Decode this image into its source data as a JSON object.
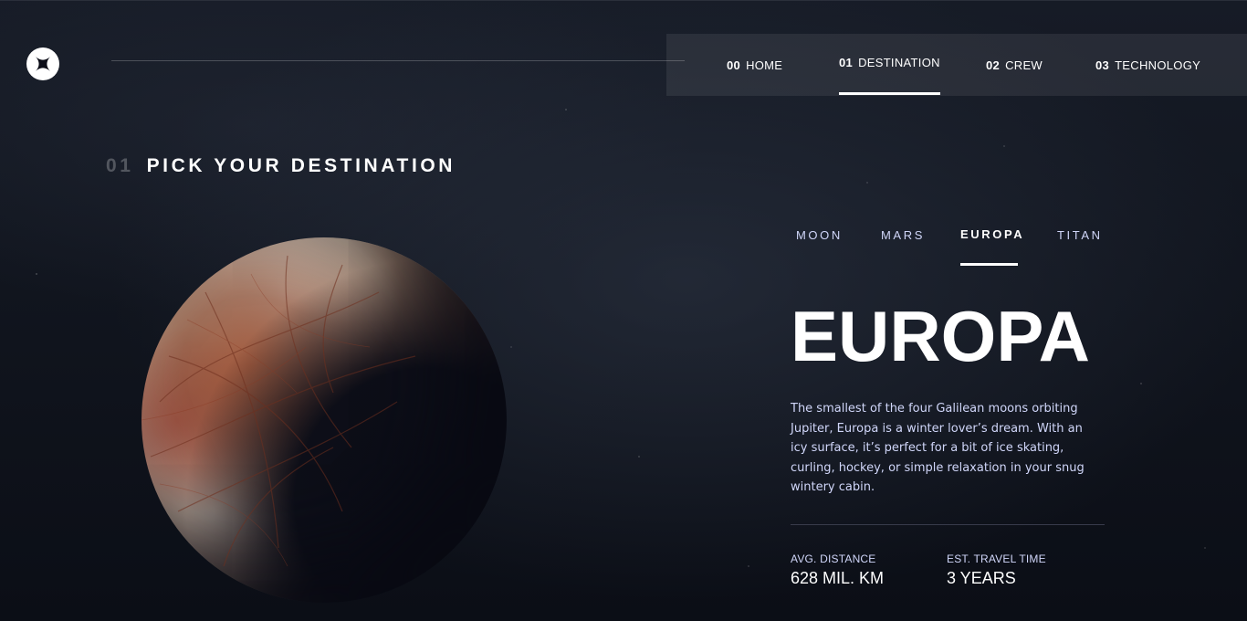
{
  "header": {
    "logo_icon": "star-logo-icon",
    "nav": [
      {
        "num": "00",
        "label": "HOME"
      },
      {
        "num": "01",
        "label": "DESTINATION"
      },
      {
        "num": "02",
        "label": "CREW"
      },
      {
        "num": "03",
        "label": "TECHNOLOGY"
      }
    ],
    "active_nav": "DESTINATION"
  },
  "section": {
    "num": "01",
    "title": "PICK YOUR DESTINATION"
  },
  "destination": {
    "image_icon": "europa-planet-image",
    "tabs": [
      "MOON",
      "MARS",
      "EUROPA",
      "TITAN"
    ],
    "active_tab": "EUROPA",
    "name": "EUROPA",
    "description": "The smallest of the four Galilean moons orbiting Jupiter, Europa is a winter lover’s dream. With an icy surface, it’s perfect for a bit of ice skating, curling, hockey, or simple relaxation in your snug wintery cabin.",
    "stats": {
      "distance_label": "AVG. DISTANCE",
      "distance_value": "628 MIL. KM",
      "travel_label": "EST. TRAVEL TIME",
      "travel_value": "3 YEARS"
    }
  },
  "colors": {
    "background": "#0b0d17",
    "text": "#ffffff",
    "muted_text": "#d0d6f9",
    "nav_bg": "rgba(255,255,255,0.08)"
  }
}
